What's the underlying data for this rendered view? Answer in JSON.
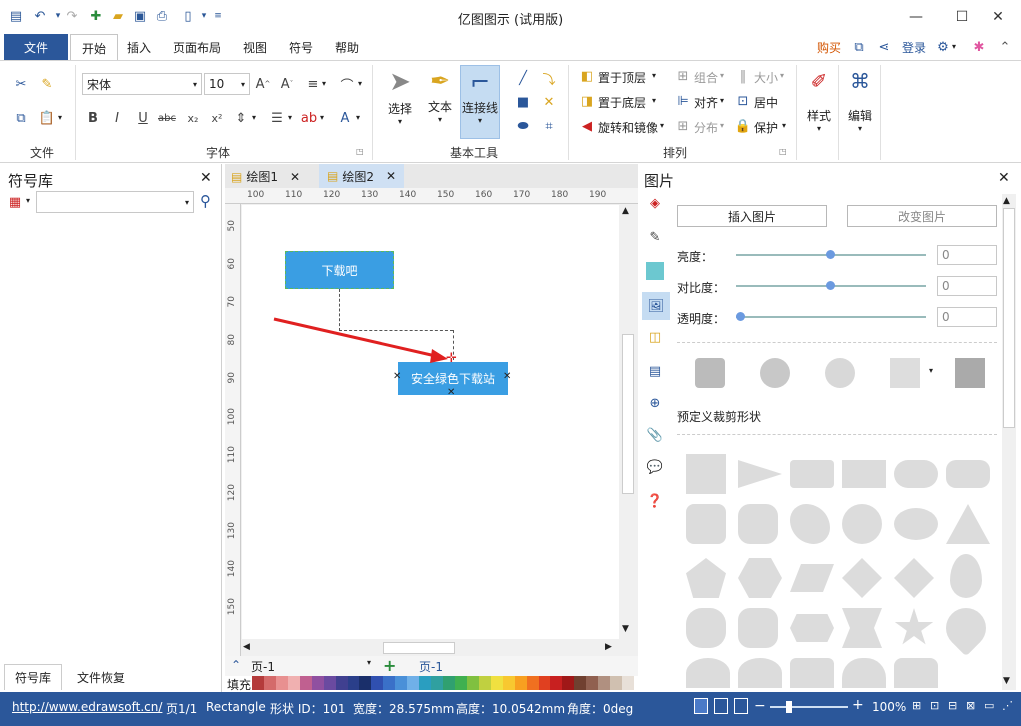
{
  "app": {
    "title": "亿图图示 (试用版)"
  },
  "quick_access": {
    "icons": [
      "app-logo-icon",
      "undo-icon",
      "redo-icon",
      "new-icon",
      "open-icon",
      "save-icon",
      "print-icon",
      "customize-icon"
    ]
  },
  "tabs": [
    {
      "label": "文件"
    },
    {
      "label": "开始"
    },
    {
      "label": "插入"
    },
    {
      "label": "页面布局"
    },
    {
      "label": "视图"
    },
    {
      "label": "符号"
    },
    {
      "label": "帮助"
    }
  ],
  "top_right": {
    "buy": "购买",
    "login": "登录"
  },
  "ribbon": {
    "groups": {
      "file": "文件",
      "font": "字体",
      "basic_tools": "基本工具",
      "arrange": "排列"
    },
    "font": {
      "family": "宋体",
      "size": "10"
    },
    "tools": {
      "select": "选择",
      "text": "文本",
      "connector": "连接线"
    },
    "arrange": {
      "bring_front": "置于顶层",
      "send_back": "置于底层",
      "rotate": "旋转和镜像",
      "group": "组合",
      "align": "对齐",
      "distribute": "分布",
      "size": "大小",
      "center": "居中",
      "protect": "保护"
    },
    "style": "样式",
    "edit": "编辑"
  },
  "left_panel": {
    "title": "符号库",
    "tabs": [
      "符号库",
      "文件恢复"
    ]
  },
  "doc_tabs": [
    {
      "label": "绘图1"
    },
    {
      "label": "绘图2"
    }
  ],
  "ruler": {
    "h": [
      "100",
      "110",
      "120",
      "130",
      "140",
      "150",
      "160",
      "170",
      "180",
      "190"
    ],
    "v": [
      "50",
      "60",
      "70",
      "80",
      "90",
      "100",
      "110",
      "120",
      "130",
      "140",
      "150"
    ]
  },
  "diagram": {
    "box1": "下载吧",
    "box2": "安全绿色下载站"
  },
  "page_nav": {
    "select": "页-1",
    "current": "页-1",
    "fill": "填充"
  },
  "right_panel": {
    "title": "图片",
    "insert_btn": "插入图片",
    "change_btn": "改变图片",
    "brightness": {
      "label": "亮度：",
      "value": "0",
      "level": 0.5
    },
    "contrast": {
      "label": "对比度：",
      "value": "0",
      "level": 0.5
    },
    "transparency": {
      "label": "透明度：",
      "value": "0",
      "level": 0
    },
    "crop_title": "预定义裁剪形状"
  },
  "status": {
    "url": "http://www.edrawsoft.cn/",
    "page": "页1/1",
    "shape": "Rectangle",
    "id": "形状 ID：101",
    "width": "宽度：28.575mm",
    "height": "高度：10.0542mm",
    "angle": "角度：0deg",
    "zoom": "100%"
  }
}
